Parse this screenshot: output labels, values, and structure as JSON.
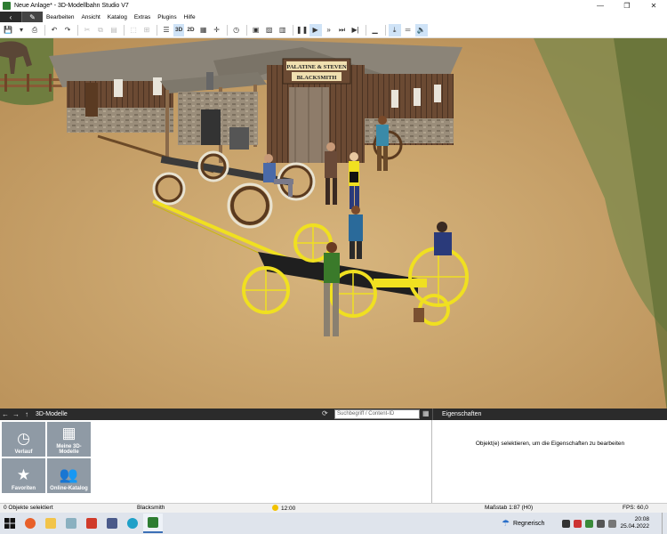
{
  "window": {
    "title": "Neue Anlage* - 3D-Modellbahn Studio V7",
    "minimize": "—",
    "maximize": "❐",
    "close": "✕"
  },
  "menu": {
    "back_glyph": "‹",
    "edit_glyph": "✎",
    "items": [
      "Bearbeiten",
      "Ansicht",
      "Katalog",
      "Extras",
      "Plugins",
      "Hilfe"
    ]
  },
  "toolbar": {
    "view_3d": "3D",
    "view_2d": "2D"
  },
  "viewport": {
    "sign_line1": "PALATINE & STEVEN",
    "sign_line2": "BLACKSMITH"
  },
  "catalog_panel": {
    "title": "3D-Modelle",
    "search_placeholder": "Suchbegriff / Content-ID",
    "tiles": [
      {
        "label": "Verlauf",
        "icon": "clock-icon"
      },
      {
        "label": "Meine 3D-Modelle",
        "icon": "grid-icon"
      },
      {
        "label": "Favoriten",
        "icon": "star-icon"
      },
      {
        "label": "Online-Katalog",
        "icon": "people-icon"
      }
    ]
  },
  "properties_panel": {
    "title": "Eigenschaften",
    "message": "Objekt(e) selektieren, um die Eigenschaften zu bearbeiten"
  },
  "statusbar": {
    "selection": "0 Objekte selektiert",
    "object_name": "Blacksmith",
    "time": "12:00",
    "scale": "Maßstab 1:87 (H0)",
    "fps": "FPS: 60,0"
  },
  "taskbar": {
    "weather": "Regnerisch",
    "clock_time": "20:08",
    "clock_date": "25.04.2022"
  },
  "colors": {
    "accent_dark": "#2b2b2b",
    "tile": "#8f9aa5",
    "wheel_yellow": "#f0e020",
    "ground": "#c9a56d"
  }
}
